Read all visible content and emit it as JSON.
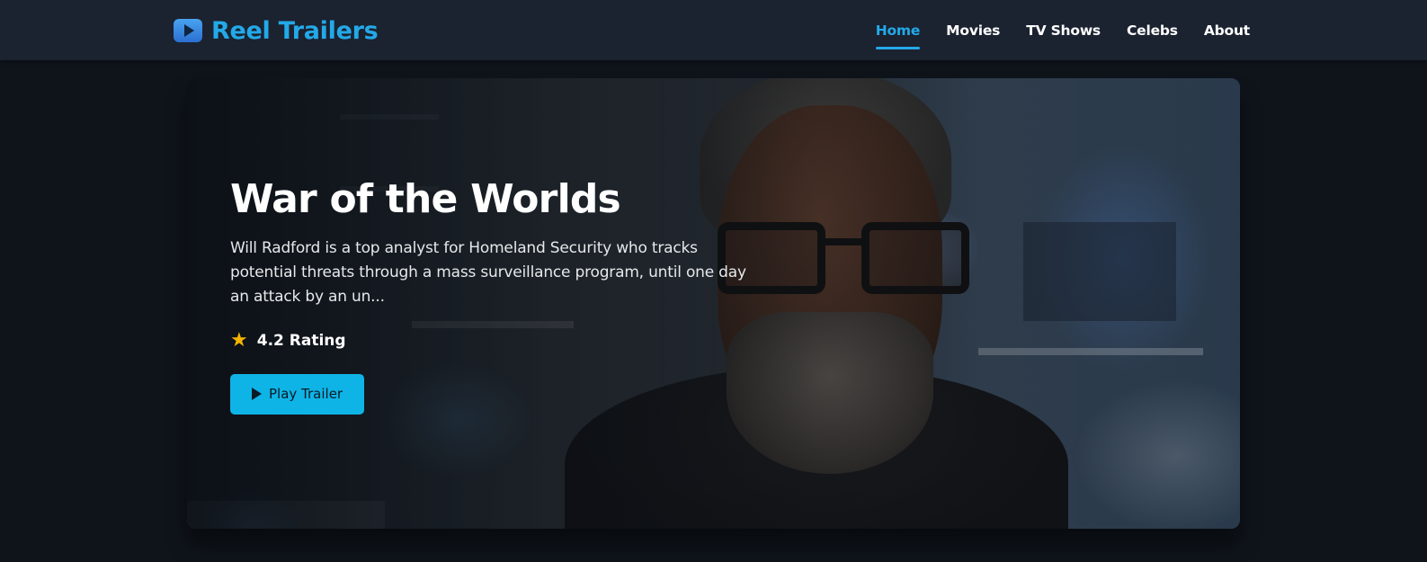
{
  "header": {
    "brand": "Reel Trailers",
    "brand_icon": "play-icon",
    "nav": [
      {
        "label": "Home",
        "active": true
      },
      {
        "label": "Movies",
        "active": false
      },
      {
        "label": "TV Shows",
        "active": false
      },
      {
        "label": "Celebs",
        "active": false
      },
      {
        "label": "About",
        "active": false
      }
    ]
  },
  "hero": {
    "title": "War of the Worlds",
    "description": "Will Radford is a top analyst for Homeland Security who tracks potential threats through a mass surveillance program, until one day an attack by an un...",
    "rating_icon": "star-icon",
    "rating_text": "4.2 Rating",
    "play_label": "Play Trailer"
  },
  "colors": {
    "accent": "#23a9e8",
    "button": "#0fb4e6",
    "header_bg": "#1b2230",
    "page_bg": "#0f141b",
    "star": "#f5b400"
  }
}
